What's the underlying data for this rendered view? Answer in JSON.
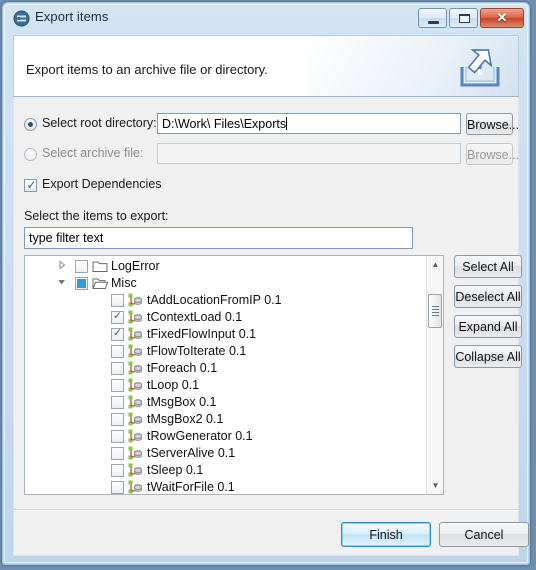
{
  "window": {
    "title": "Export items",
    "icon": "export-app-icon",
    "controls": [
      {
        "name": "minimize-button",
        "glyph": "minimize-icon"
      },
      {
        "name": "maximize-button",
        "glyph": "maximize-icon"
      },
      {
        "name": "close-button",
        "glyph": "close-icon",
        "label": "✕"
      }
    ]
  },
  "header": {
    "description": "Export items to an archive file or directory.",
    "icon": "export-arrow-icon"
  },
  "form": {
    "root_directory": {
      "radio_label": "Select root directory:",
      "selected": true,
      "value": "D:\\Work\\ Files\\Exports",
      "browse_label": "Browse...",
      "browse_enabled": true
    },
    "archive_file": {
      "radio_label": "Select archive file:",
      "selected": false,
      "value": "",
      "browse_label": "Browse...",
      "browse_enabled": false
    },
    "export_dependencies": {
      "label": "Export Dependencies",
      "checked": true
    }
  },
  "tree_section": {
    "heading": "Select the items to export:",
    "filter_placeholder": "type filter text",
    "filter_value": "type filter text",
    "side_buttons": [
      {
        "name": "select-all-button",
        "label": "Select All"
      },
      {
        "name": "deselect-all-button",
        "label": "Deselect All"
      },
      {
        "name": "expand-all-button",
        "label": "Expand All"
      },
      {
        "name": "collapse-all-button",
        "label": "Collapse All"
      }
    ],
    "rows": [
      {
        "label": "LogError",
        "depth": 0,
        "arrow": "collapsed",
        "check": "unchecked",
        "icon": "folder-closed-icon"
      },
      {
        "label": "Misc",
        "depth": 0,
        "arrow": "expanded",
        "check": "partial",
        "icon": "folder-open-icon"
      },
      {
        "label": "tAddLocationFromIP 0.1",
        "depth": 1,
        "arrow": "none",
        "check": "unchecked",
        "icon": "component-icon"
      },
      {
        "label": "tContextLoad 0.1",
        "depth": 1,
        "arrow": "none",
        "check": "checked",
        "icon": "component-icon"
      },
      {
        "label": "tFixedFlowInput 0.1",
        "depth": 1,
        "arrow": "none",
        "check": "checked",
        "icon": "component-icon"
      },
      {
        "label": "tFlowToIterate 0.1",
        "depth": 1,
        "arrow": "none",
        "check": "unchecked",
        "icon": "component-icon"
      },
      {
        "label": "tForeach 0.1",
        "depth": 1,
        "arrow": "none",
        "check": "unchecked",
        "icon": "component-icon"
      },
      {
        "label": "tLoop 0.1",
        "depth": 1,
        "arrow": "none",
        "check": "unchecked",
        "icon": "component-icon"
      },
      {
        "label": "tMsgBox 0.1",
        "depth": 1,
        "arrow": "none",
        "check": "unchecked",
        "icon": "component-icon"
      },
      {
        "label": "tMsgBox2 0.1",
        "depth": 1,
        "arrow": "none",
        "check": "unchecked",
        "icon": "component-icon"
      },
      {
        "label": "tRowGenerator 0.1",
        "depth": 1,
        "arrow": "none",
        "check": "unchecked",
        "icon": "component-icon"
      },
      {
        "label": "tServerAlive 0.1",
        "depth": 1,
        "arrow": "none",
        "check": "unchecked",
        "icon": "component-icon"
      },
      {
        "label": "tSleep 0.1",
        "depth": 1,
        "arrow": "none",
        "check": "unchecked",
        "icon": "component-icon"
      },
      {
        "label": "tWaitForFile 0.1",
        "depth": 1,
        "arrow": "none",
        "check": "unchecked",
        "icon": "component-icon"
      }
    ],
    "scrollbar": {
      "up_arrow": "▲",
      "down_arrow": "▼"
    }
  },
  "footer": {
    "finish_label": "Finish",
    "cancel_label": "Cancel"
  },
  "colors": {
    "accent": "#2a8bc8",
    "titlebar": "#d3e4f3",
    "close_button": "#c64427",
    "partial_check": "#2f9ddb",
    "component_green": "#8cc63f"
  }
}
